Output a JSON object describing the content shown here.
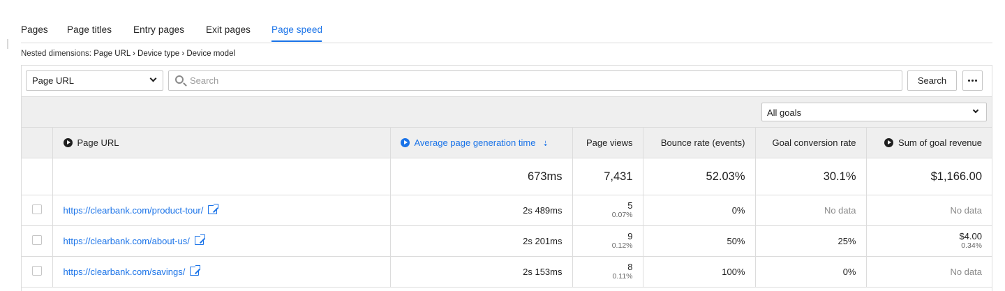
{
  "tabs": [
    {
      "label": "Pages",
      "active": false
    },
    {
      "label": "Page titles",
      "active": false
    },
    {
      "label": "Entry pages",
      "active": false
    },
    {
      "label": "Exit pages",
      "active": false
    },
    {
      "label": "Page speed",
      "active": true
    }
  ],
  "nested": {
    "prefix": "Nested dimensions:",
    "path": "Page URL › Device type › Device model"
  },
  "toolbar": {
    "dimension_value": "Page URL",
    "search_placeholder": "Search",
    "search_label": "Search"
  },
  "goals_select": "All goals",
  "columns": {
    "page_url": "Page URL",
    "avg_gen_time": "Average page generation time",
    "page_views": "Page views",
    "bounce_rate": "Bounce rate (events)",
    "goal_conv_rate": "Goal conversion rate",
    "goal_revenue": "Sum of goal revenue"
  },
  "totals": {
    "avg_gen_time": "673ms",
    "page_views": "7,431",
    "bounce_rate": "52.03%",
    "goal_conv_rate": "30.1%",
    "goal_revenue": "$1,166.00"
  },
  "rows": [
    {
      "url": "https://clearbank.com/product-tour/",
      "avg_gen_time": "2s 489ms",
      "page_views": "5",
      "page_views_pct": "0.07%",
      "bounce_rate": "0%",
      "goal_conv_rate": "No data",
      "goal_revenue": "No data",
      "goal_revenue_pct": ""
    },
    {
      "url": "https://clearbank.com/about-us/",
      "avg_gen_time": "2s 201ms",
      "page_views": "9",
      "page_views_pct": "0.12%",
      "bounce_rate": "50%",
      "goal_conv_rate": "25%",
      "goal_revenue": "$4.00",
      "goal_revenue_pct": "0.34%"
    },
    {
      "url": "https://clearbank.com/savings/",
      "avg_gen_time": "2s 153ms",
      "page_views": "8",
      "page_views_pct": "0.11%",
      "bounce_rate": "100%",
      "goal_conv_rate": "0%",
      "goal_revenue": "No data",
      "goal_revenue_pct": ""
    }
  ],
  "colors": {
    "accent": "#1a73e8",
    "header_bg": "#efefef",
    "border": "#dcdcdc",
    "muted": "#8a8a8a"
  },
  "icons": {
    "column_icon": "play-circle-icon",
    "sort_icon": "sort-descending-icon",
    "external_link": "external-link-icon",
    "search": "search-icon",
    "more": "more-horizontal-icon",
    "dropdown": "chevron-down-icon"
  }
}
